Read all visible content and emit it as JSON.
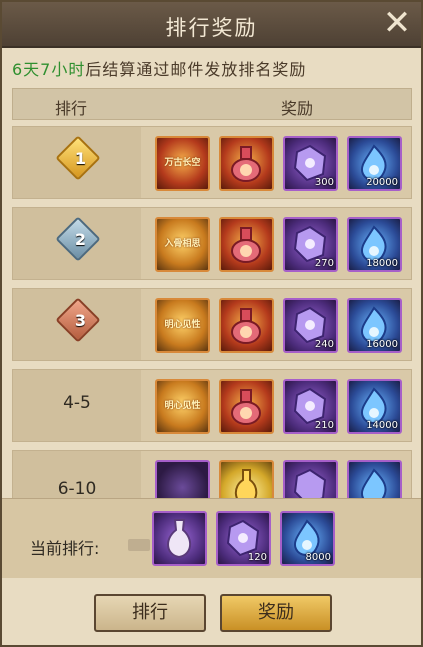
{
  "title": "排行奖励",
  "notice": {
    "time": "6天7小时",
    "text": "后结算通过邮件发放排名奖励"
  },
  "header": {
    "rank": "排行",
    "reward": "奖励"
  },
  "rows": [
    {
      "rank_num": "1",
      "rank_style": "gold",
      "items": [
        {
          "label": "万古长空",
          "qty": ""
        },
        {
          "label": "",
          "qty": ""
        },
        {
          "label": "",
          "qty": "300"
        },
        {
          "label": "",
          "qty": "20000"
        }
      ]
    },
    {
      "rank_num": "2",
      "rank_style": "silver",
      "items": [
        {
          "label": "入骨相思",
          "qty": ""
        },
        {
          "label": "",
          "qty": ""
        },
        {
          "label": "",
          "qty": "270"
        },
        {
          "label": "",
          "qty": "18000"
        }
      ]
    },
    {
      "rank_num": "3",
      "rank_style": "bronze",
      "items": [
        {
          "label": "明心见性",
          "qty": ""
        },
        {
          "label": "",
          "qty": ""
        },
        {
          "label": "",
          "qty": "240"
        },
        {
          "label": "",
          "qty": "16000"
        }
      ]
    },
    {
      "rank_text": "4-5",
      "items": [
        {
          "label": "明心见性",
          "qty": ""
        },
        {
          "label": "",
          "qty": ""
        },
        {
          "label": "",
          "qty": "210"
        },
        {
          "label": "",
          "qty": "14000"
        }
      ]
    },
    {
      "rank_text": "6-10",
      "items": [
        {
          "label": "",
          "qty": ""
        },
        {
          "label": "",
          "qty": ""
        },
        {
          "label": "",
          "qty": ""
        },
        {
          "label": "",
          "qty": ""
        }
      ]
    }
  ],
  "current": {
    "label": "当前排行:",
    "items": [
      {
        "qty": ""
      },
      {
        "qty": "120"
      },
      {
        "qty": "8000"
      }
    ]
  },
  "buttons": {
    "rank": "排行",
    "reward": "奖励"
  }
}
